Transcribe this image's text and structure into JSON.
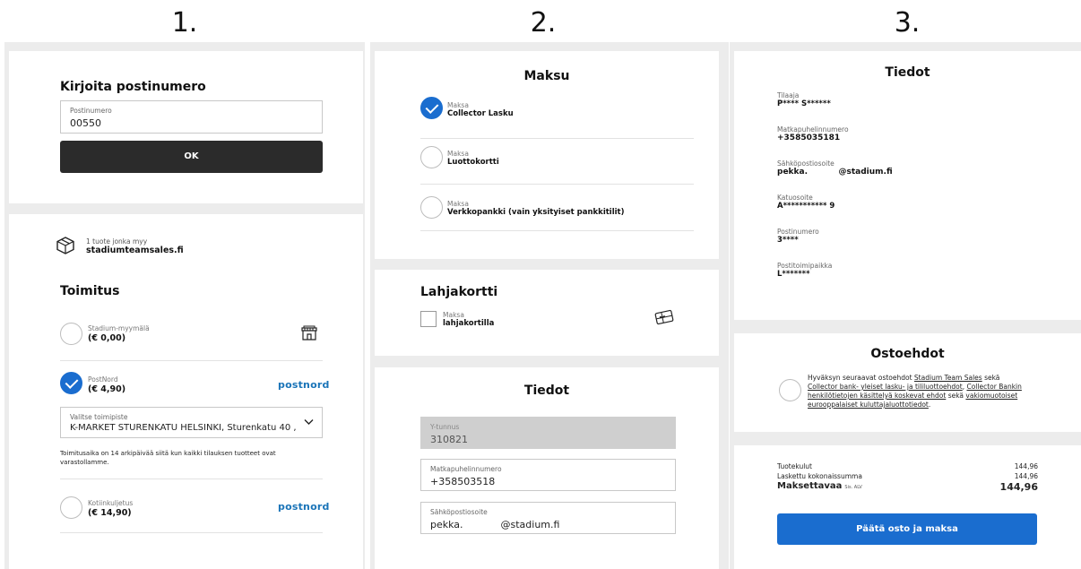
{
  "steps": [
    "1.",
    "2.",
    "3."
  ],
  "step1": {
    "postcode_title": "Kirjoita postinumero",
    "postcode_label": "Postinumero",
    "postcode_value": "00550",
    "ok_label": "OK",
    "seller_prefix": "1 tuote jonka myy",
    "seller_name": "stadiumteamsales.fi",
    "delivery_title": "Toimitus",
    "options": [
      {
        "name": "Stadium-myymälä",
        "price": "(€ 0,00)",
        "checked": false
      },
      {
        "name": "PostNord",
        "price": "(€ 4,90)",
        "checked": true,
        "brand": "postnord"
      },
      {
        "name": "Kotiinkuljetus",
        "price": "(€ 14,90)",
        "checked": false,
        "brand": "postnord"
      }
    ],
    "pickup_label": "Valitse toimipiste",
    "pickup_value": "K-MARKET STURENKATU HELSINKI, Sturenkatu 40 ,",
    "delivery_note_1": "Toimitusaika on 14 arkipäivää siitä kun kaikki tilauksen tuotteet ovat",
    "delivery_note_2": "varastollamme."
  },
  "step2": {
    "payment_title": "Maksu",
    "payment_options": [
      {
        "label": "Maksa",
        "name": "Collector Lasku",
        "checked": true
      },
      {
        "label": "Maksa",
        "name": "Luottokortti",
        "checked": false
      },
      {
        "label": "Maksa",
        "name": "Verkkopankki (vain yksityiset pankkitilit)",
        "checked": false
      }
    ],
    "giftcard_title": "Lahjakortti",
    "giftcard_label": "Maksa",
    "giftcard_name": "lahjakortilla",
    "info_title": "Tiedot",
    "fields": [
      {
        "label": "Y-tunnus",
        "value": "310821",
        "disabled": true
      },
      {
        "label": "Matkapuhelinnumero",
        "value": "+358503518",
        "disabled": false
      },
      {
        "label": "Sähköpostiosoite",
        "value": "pekka.            @stadium.fi",
        "disabled": false
      }
    ]
  },
  "step3": {
    "info_title": "Tiedot",
    "info_rows": [
      {
        "label": "Tilaaja",
        "value": "P**** S******"
      },
      {
        "label": "Matkapuhelinnumero",
        "value": "+3585035181"
      },
      {
        "label": "Sähköpostiosoite",
        "value": "pekka.           @stadium.fi"
      },
      {
        "label": "Katuosoite",
        "value": "A*********** 9"
      },
      {
        "label": "Postinumero",
        "value": "3****"
      },
      {
        "label": "Postitoimipaikka",
        "value": "L*******"
      }
    ],
    "terms_title": "Ostoehdot",
    "terms_l1_a": "Hyväksyn seuraavat ostoehdot ",
    "terms_l1_link": "Stadium Team Sales",
    "terms_l1_b": " sekä",
    "terms_l2_link": "Collector bank- yleiset lasku- ja tililuottoehdot",
    "terms_l2_b": ", ",
    "terms_l2_link2": "Collector Bankin",
    "terms_l3_link": "henkilötietojen käsittelyä koskevat ehdot",
    "terms_l3_b": " sekä ",
    "terms_l3_link2": "vakiomuotoiset",
    "terms_l4_link": "eurooppalaiset kuluttajaluottotiedot",
    "terms_l4_b": ".",
    "summary": [
      {
        "label": "Tuotekulut",
        "value": "144,96"
      },
      {
        "label": "Laskettu kokonaissumma",
        "value": "144,96"
      }
    ],
    "total_label": "Maksettavaa",
    "total_vat": "Sis. ALV",
    "total_value": "144,96",
    "pay_label": "Päätä osto ja maksa"
  },
  "colors": {
    "accent": "#1a6dcf",
    "postnord": "#1a74b8",
    "dark_button": "#2b2b2b"
  }
}
